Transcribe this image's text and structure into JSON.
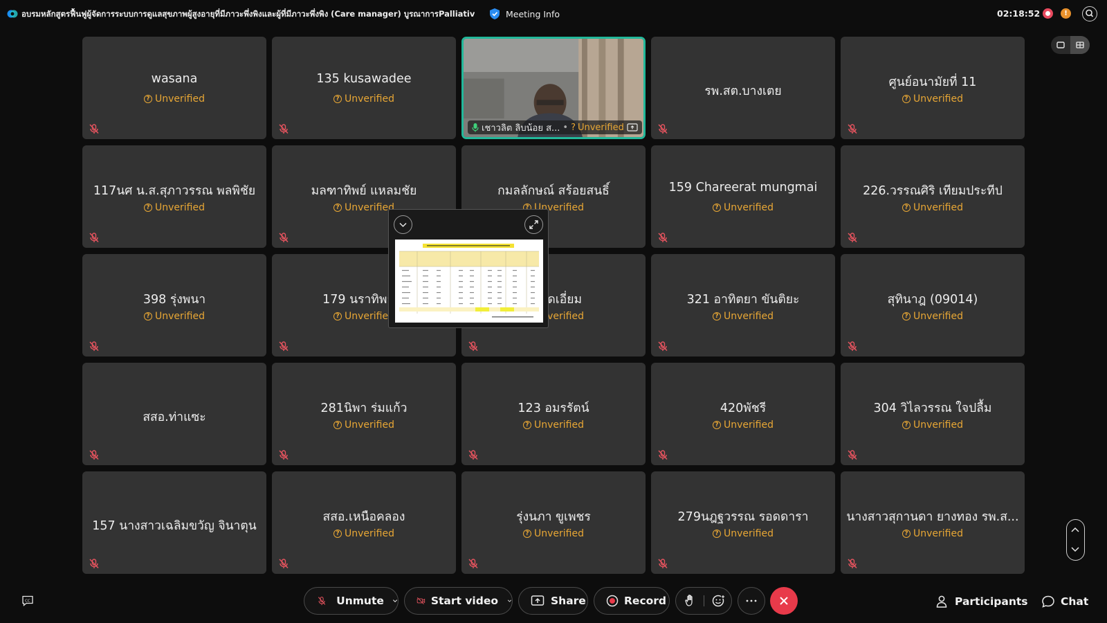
{
  "window": {
    "title": "อบรมหลักสูตรฟื้นฟูผู้จัดการระบบการดูแลสุขภาพผู้สูงอายุที่มีภาวะพึ่งพิงและผู้ที่มีภาวะพึ่งพิง (Care manager) บูรณาการPalliative c",
    "meeting_info_label": "Meeting Info",
    "timer": "02:18:52"
  },
  "unverified_label": "Unverified",
  "participants": [
    {
      "name": "wasana",
      "verified": false
    },
    {
      "name": "135 kusawadee",
      "verified": false
    },
    {
      "name": "เชาวลิต ลิบน้อย ส...",
      "verified": false,
      "video": true
    },
    {
      "name": "รพ.สต.บางเตย",
      "verified": true
    },
    {
      "name": "ศูนย์อนามัยที่ 11",
      "verified": false
    },
    {
      "name": "117นศ น.ส.สุภาวรรณ พลพิชัย",
      "verified": false
    },
    {
      "name": "มลฑาทิพย์ แหลมชัย",
      "verified": false
    },
    {
      "name": "กมลลักษณ์ สร้อยสนธิ์",
      "verified": false
    },
    {
      "name": "159 Chareerat mungmai",
      "verified": false
    },
    {
      "name": "226.วรรณศิริ เทียมประทีป",
      "verified": false
    },
    {
      "name": "398 รุ่งพนา",
      "verified": false
    },
    {
      "name": "179 นราทิพย์ สุ",
      "verified": false
    },
    {
      "name": "ณ์ สุดเอี่ยม",
      "verified": false
    },
    {
      "name": "321 อาทิตยา ขันติยะ",
      "verified": false
    },
    {
      "name": "สุทินาฎ (09014)",
      "verified": false
    },
    {
      "name": "สสอ.ท่าแซะ",
      "verified": true
    },
    {
      "name": "281นิพา ร่มแก้ว",
      "verified": false
    },
    {
      "name": "123 อมรรัตน์",
      "verified": false
    },
    {
      "name": "420พัชรี",
      "verified": false
    },
    {
      "name": "304 วิไลวรรณ ใจปลื้ม",
      "verified": false
    },
    {
      "name": "157 นางสาวเฉลิมขวัญ จินาตุน",
      "verified": true
    },
    {
      "name": "สสอ.เหนือคลอง",
      "verified": false
    },
    {
      "name": "รุ่งนภา ขูเพชร",
      "verified": false
    },
    {
      "name": "279นฎฐวรรณ รอดดารา",
      "verified": false
    },
    {
      "name": "นางสาวสุกานดา ยางทอง รพ.ส...",
      "verified": false
    }
  ],
  "toolbar": {
    "unmute": "Unmute",
    "start_video": "Start video",
    "share": "Share",
    "record": "Record",
    "participants": "Participants",
    "chat": "Chat"
  },
  "colors": {
    "background": "#0d0d0d",
    "tile": "#333333",
    "unverified": "#e8a735",
    "active_speaker_border": "#22b89a",
    "end_call": "#e83a4a"
  }
}
